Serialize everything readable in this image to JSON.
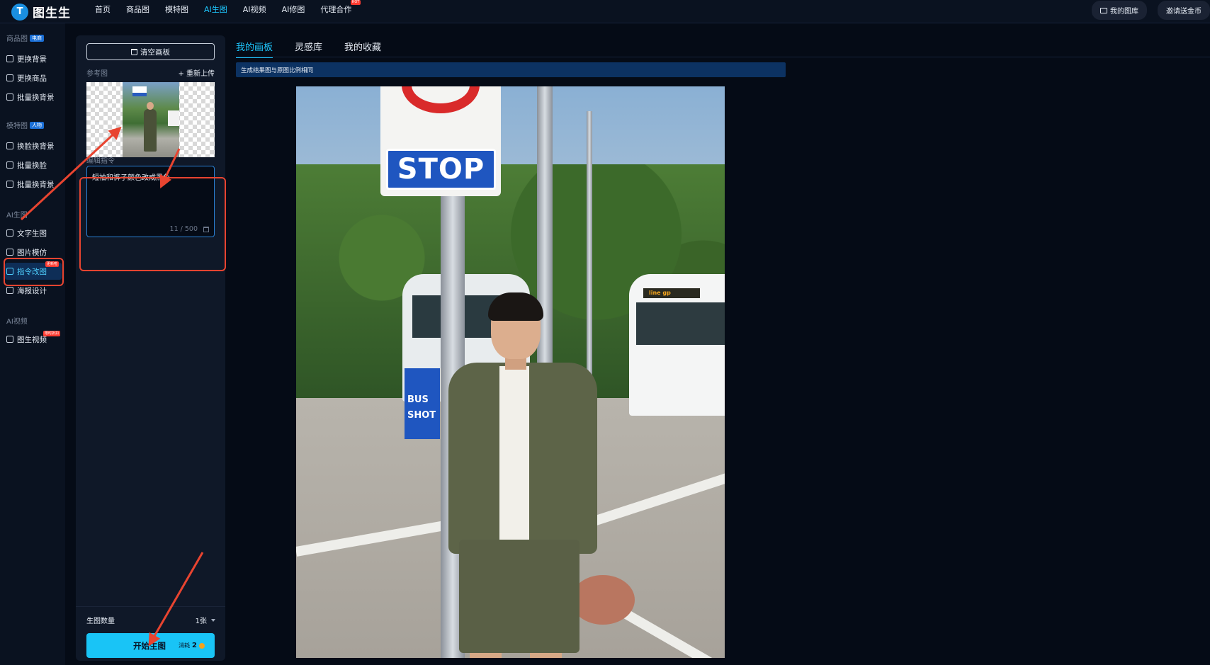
{
  "topbar": {
    "logo_text": "图生生",
    "nav": [
      {
        "label": "首页"
      },
      {
        "label": "商品图"
      },
      {
        "label": "模特图"
      },
      {
        "label": "AI生图",
        "active": true
      },
      {
        "label": "AI视频"
      },
      {
        "label": "AI修图"
      },
      {
        "label": "代理合作",
        "badge": "HOT"
      }
    ],
    "my_gallery": "我的图库",
    "invite": "邀请送金币"
  },
  "sidebar": {
    "groups": [
      {
        "title": "商品图",
        "tag": "电商"
      },
      {
        "title": "模特图",
        "tag": "人物"
      },
      {
        "title": "AI生图"
      },
      {
        "title": "AI视频"
      }
    ],
    "items": [
      {
        "label": "更换背景",
        "icon": "image-swap-icon"
      },
      {
        "label": "更换商品",
        "icon": "product-swap-icon"
      },
      {
        "label": "批量换背景",
        "icon": "batch-bg-icon"
      },
      {
        "label": "换脸换背景",
        "icon": "face-bg-icon"
      },
      {
        "label": "批量换脸",
        "icon": "face-batch-icon"
      },
      {
        "label": "批量换背景",
        "icon": "batch-bg-icon"
      },
      {
        "label": "文字生图",
        "icon": "text-image-icon"
      },
      {
        "label": "图片模仿",
        "icon": "image-mimic-icon"
      },
      {
        "label": "指令改图",
        "icon": "edit-pen-icon",
        "active": true,
        "badge": "更新啦"
      },
      {
        "label": "海报设计",
        "icon": "poster-icon"
      },
      {
        "label": "图生视频",
        "icon": "video-icon",
        "badge": "限时折扣"
      }
    ]
  },
  "panel": {
    "clear_label": "清空画板",
    "ref_label": "参考图",
    "reupload_label": "+ 重新上传",
    "cmd_label": "编辑指令",
    "cmd_text": "短袖和裤子颜色改成黑色",
    "cmd_count": "11 / 500",
    "qty_label": "生图数量",
    "qty_value": "1张",
    "start_label": "开始生图",
    "cost_label": "消耗",
    "cost_value": "2"
  },
  "main": {
    "tabs": [
      {
        "label": "我的画板",
        "active": true
      },
      {
        "label": "灵感库"
      },
      {
        "label": "我的收藏"
      }
    ],
    "notice": "生成结果图与原图比例相同"
  },
  "result_image": {
    "stop_text": "STOP",
    "bus_sign_text": "BUS\nSHOT",
    "bus_led": "line gp"
  },
  "colors": {
    "accent": "#1ec8ff",
    "annotation": "#e84430",
    "start_button": "#19c4f6"
  }
}
